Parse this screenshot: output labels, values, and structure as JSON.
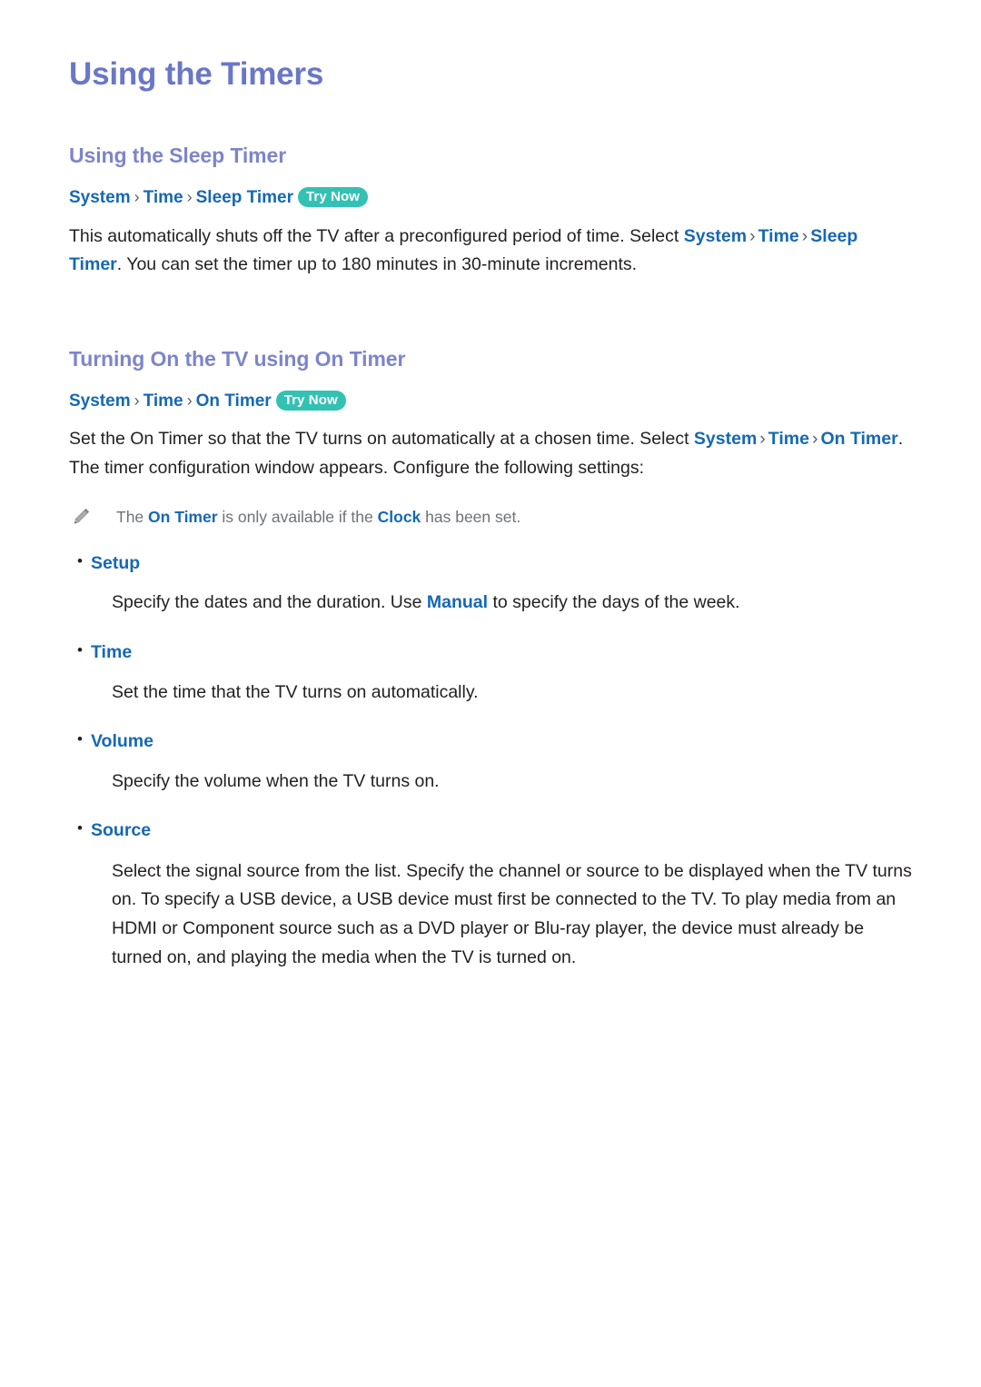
{
  "document": {
    "title": "Using the Timers"
  },
  "sections": [
    {
      "heading": "Using the Sleep Timer",
      "breadcrumb": {
        "items": [
          "System",
          "Time",
          "Sleep Timer"
        ],
        "separator": "›",
        "badge": "Try Now"
      },
      "paragraph": {
        "part1": "This automatically shuts off the TV after a preconfigured period of time. Select ",
        "link1": "System",
        "sep1": "›",
        "link2": "Time",
        "sep2": "›",
        "link3": "Sleep Timer",
        "part2": ". You can set the timer up to 180 minutes in 30-minute increments."
      }
    },
    {
      "heading": "Turning On the TV using On Timer",
      "breadcrumb": {
        "items": [
          "System",
          "Time",
          "On Timer"
        ],
        "separator": "›",
        "badge": "Try Now"
      },
      "paragraph": {
        "part1": "Set the On Timer so that the TV turns on automatically at a chosen time. Select ",
        "link1": "System",
        "sep1": "›",
        "link2": "Time",
        "sep2": "›",
        "link3": "On Timer",
        "part2": ". The timer configuration window appears. Configure the following settings:"
      },
      "note": {
        "icon": "pencil-icon",
        "part1": "The ",
        "link1": "On Timer",
        "part2": " is only available if the ",
        "link2": "Clock",
        "part3": " has been set."
      },
      "bullets": [
        {
          "label": "Setup",
          "desc_part1": "Specify the dates and the duration. Use ",
          "desc_link": "Manual",
          "desc_part2": " to specify the days of the week."
        },
        {
          "label": "Time",
          "desc_part1": "Set the time that the TV turns on automatically.",
          "desc_link": "",
          "desc_part2": ""
        },
        {
          "label": "Volume",
          "desc_part1": "Specify the volume when the TV turns on.",
          "desc_link": "",
          "desc_part2": ""
        },
        {
          "label": "Source",
          "desc_part1": "Select the signal source from the list. Specify the channel or source to be displayed when the TV turns on. To specify a USB device, a USB device must first be connected to the TV. To play media from an HDMI or Component source such as a DVD player or Blu-ray player, the device must already be turned on, and playing the media when the TV is turned on.",
          "desc_link": "",
          "desc_part2": ""
        }
      ]
    }
  ],
  "symbols": {
    "bullet": "•"
  },
  "colors": {
    "title": "#6a77c6",
    "section_heading": "#7d85c9",
    "link_blue": "#1668b3",
    "badge_teal": "#33c1b4",
    "body_text": "#231f20",
    "note_text": "#6d7278"
  }
}
